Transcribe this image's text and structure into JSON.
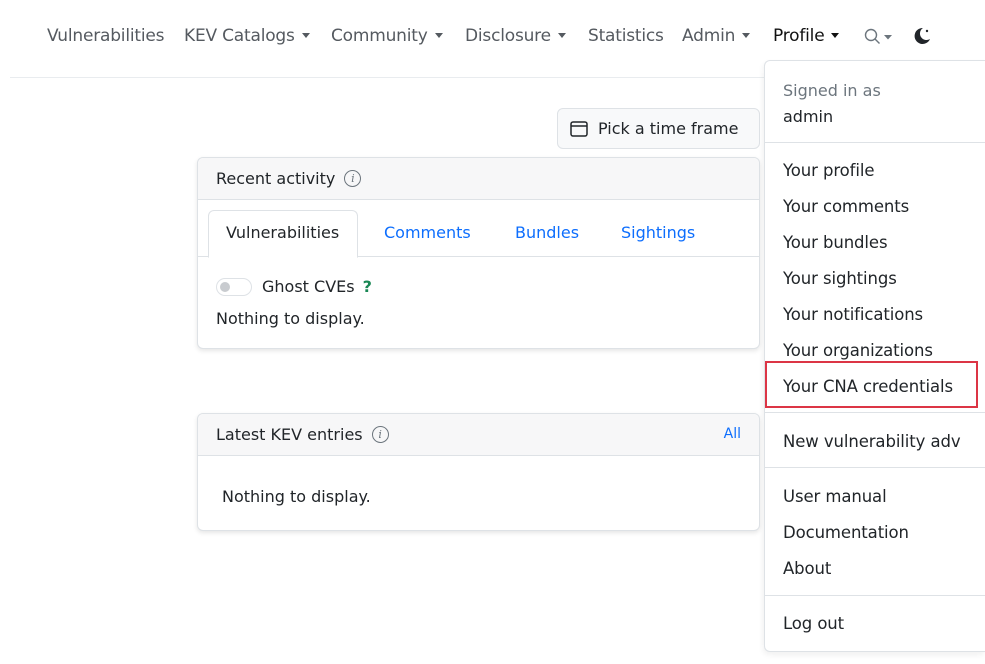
{
  "nav": {
    "items": [
      {
        "label": "Vulnerabilities"
      },
      {
        "label": "KEV Catalogs"
      },
      {
        "label": "Community"
      },
      {
        "label": "Disclosure"
      },
      {
        "label": "Statistics"
      },
      {
        "label": "Admin"
      },
      {
        "label": "Profile"
      }
    ],
    "search_icon": "search-icon",
    "theme_icon": "moon-icon"
  },
  "timeframe": {
    "label": "Pick a time frame",
    "icon": "calendar-icon"
  },
  "recent_activity": {
    "title": "Recent activity",
    "info_glyph": "i",
    "tabs": [
      {
        "label": "Vulnerabilities"
      },
      {
        "label": "Comments"
      },
      {
        "label": "Bundles"
      },
      {
        "label": "Sightings"
      }
    ],
    "ghost_label": "Ghost CVEs",
    "ghost_help": "?",
    "empty": "Nothing to display."
  },
  "kev": {
    "title": "Latest KEV entries",
    "info_glyph": "i",
    "all_link": "All",
    "empty": "Nothing to display."
  },
  "profile_menu": {
    "signed_in_as": "Signed in as",
    "username": "admin",
    "group1": [
      {
        "label": "Your profile"
      },
      {
        "label": "Your comments"
      },
      {
        "label": "Your bundles"
      },
      {
        "label": "Your sightings"
      },
      {
        "label": "Your notifications"
      },
      {
        "label": "Your organizations"
      },
      {
        "label": "Your CNA credentials"
      }
    ],
    "new_advisory": "New vulnerability adv",
    "group2": [
      {
        "label": "User manual"
      },
      {
        "label": "Documentation"
      },
      {
        "label": "About"
      }
    ],
    "logout": "Log out"
  },
  "colors": {
    "link": "#0d6efd",
    "highlight": "#dc3545",
    "help": "#198754"
  }
}
